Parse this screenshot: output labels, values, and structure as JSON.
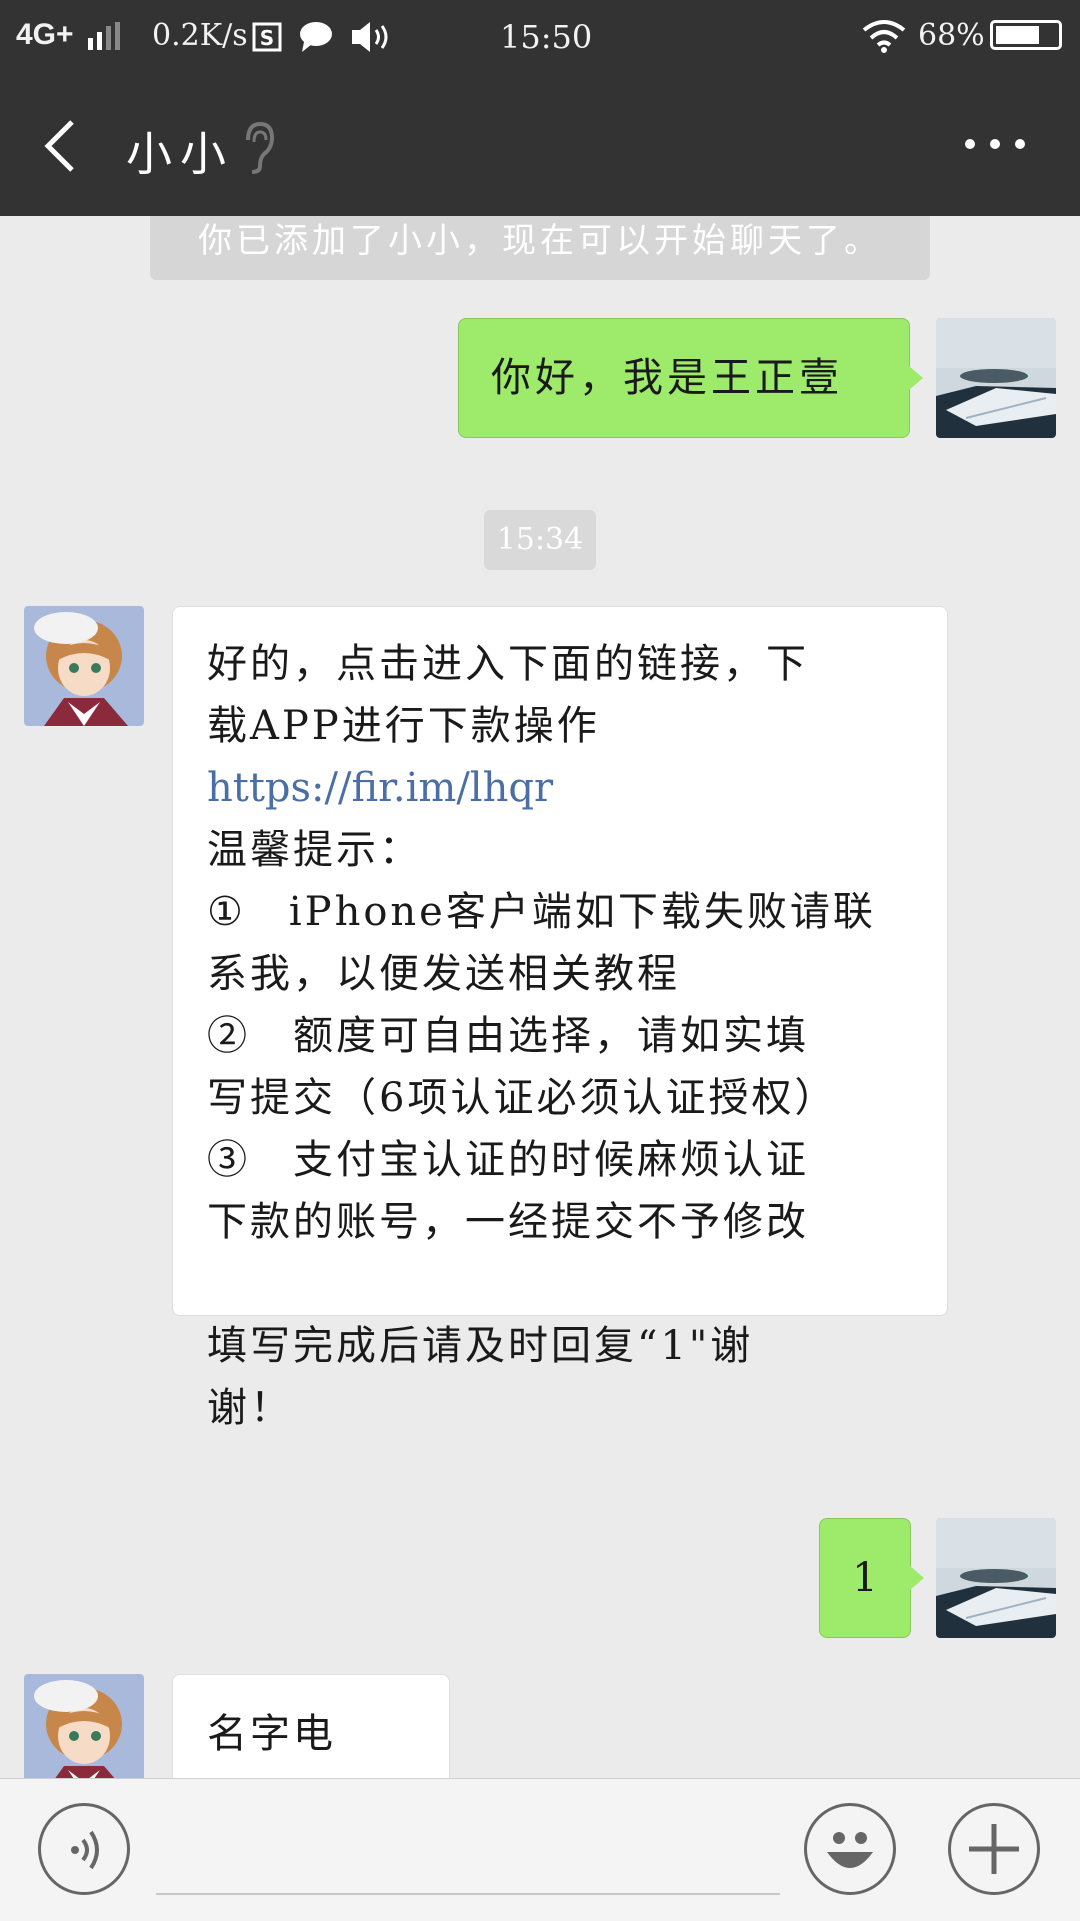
{
  "status_bar": {
    "network": "4G+",
    "speed": "0.2K/s",
    "time": "15:50",
    "battery": "68%"
  },
  "header": {
    "title": "小小",
    "icons": [
      "back-arrow-icon",
      "ear-icon",
      "more-icon"
    ]
  },
  "chat": {
    "system_notice": "你已添加了小小，现在可以开始聊天了。",
    "timestamp": "15:34",
    "messages": [
      {
        "from": "me",
        "text": "你好，我是王正壹"
      },
      {
        "from": "contact",
        "lines": [
          "好的，点击进入下面的链接，下",
          "载APP进行下款操作",
          "https://fir.im/lhqr",
          "温馨提示：",
          "①　iPhone客户端如下载失败请联",
          "系我，以便发送相关教程",
          "②　额度可自由选择，请如实填",
          "写提交（6项认证必须认证授权）",
          "③　支付宝认证的时候麻烦认证",
          "下款的账号，一经提交不予修改",
          "",
          "填写完成后请及时回复“1\"谢",
          "谢！"
        ]
      },
      {
        "from": "me",
        "text": "1"
      },
      {
        "from": "contact",
        "text": "名字电话？"
      }
    ]
  },
  "input_bar": {
    "icons": [
      "voice-icon",
      "emoji-icon",
      "plus-icon"
    ]
  },
  "colors": {
    "header_bg": "#333333",
    "chat_bg": "#ebebeb",
    "outgoing_bubble": "#9eea6a",
    "incoming_bubble": "#ffffff",
    "link": "#4a6ea5"
  }
}
